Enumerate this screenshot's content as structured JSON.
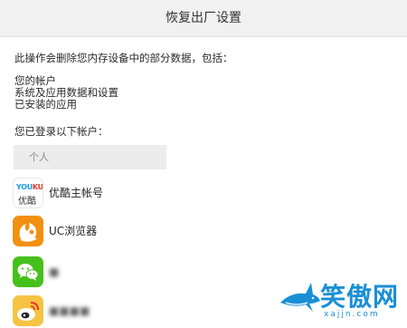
{
  "header": {
    "title": "恢复出厂设置"
  },
  "description": {
    "intro": "此操作会删除您内存设备中的部分数据，包括：",
    "items": [
      "您的帐户",
      "系统及应用数据和设置",
      "已安装的应用"
    ],
    "logged_in_label": "您已登录以下帐户："
  },
  "accounts": {
    "group_label": "个人",
    "items": [
      {
        "name": "优酷主帐号",
        "icon": "youku-icon",
        "icon_text_top": "YOUKU",
        "icon_text_bottom": "优酷"
      },
      {
        "name": "UC浏览器",
        "icon": "uc-browser-icon"
      },
      {
        "name": "■",
        "icon": "wechat-icon",
        "blurred": true
      },
      {
        "name": "■■■■",
        "icon": "weibo-icon",
        "blurred": true
      }
    ]
  },
  "watermark": {
    "text": "笑傲网",
    "url": "xajjn.com",
    "icon": "shark-logo"
  },
  "colors": {
    "titlebar_bg": "#f1f1f1",
    "uc_orange": "#f29011",
    "wechat_green": "#46c01b",
    "weibo_yellow": "#f6c342",
    "youku_blue": "#1e9be8",
    "youku_red": "#e8352a",
    "watermark_blue": "#1a8fd6"
  }
}
